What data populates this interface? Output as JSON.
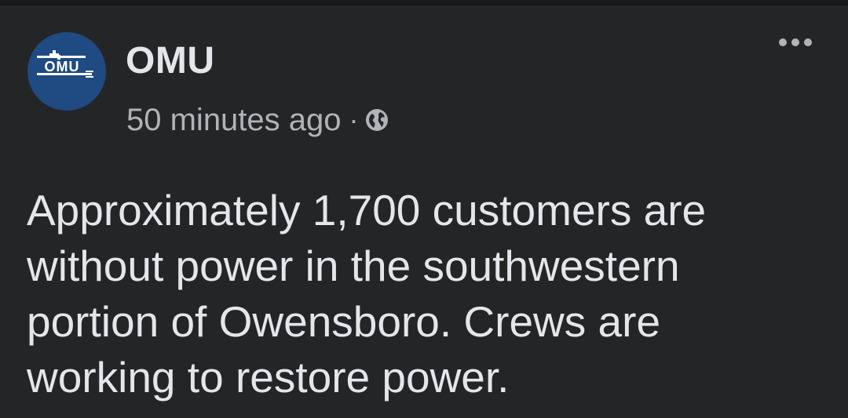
{
  "post": {
    "author": "OMU",
    "avatar_logo_text": "OMU",
    "timestamp": "50 minutes ago",
    "separator": "·",
    "audience_icon": "globe-icon",
    "menu_icon": "more-options-icon",
    "text": "Approximately 1,700 customers are\nwithout power in the southwestern\nportion of Owensboro. Crews are\nworking to restore power."
  },
  "colors": {
    "background": "#242526",
    "text_primary": "#e4e6eb",
    "text_secondary": "#b0b3b8",
    "avatar_bg": "#1f4a82"
  }
}
